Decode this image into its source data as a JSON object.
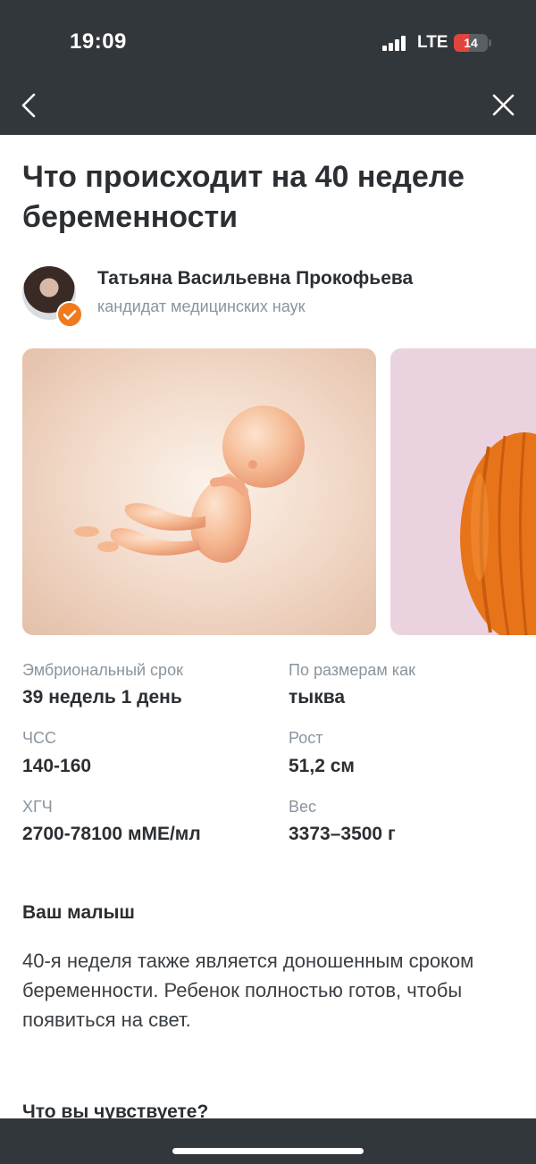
{
  "status_bar": {
    "time": "19:09",
    "network": "LTE",
    "battery": "14",
    "battery_fraction": 0.14,
    "icons": [
      "signal-icon",
      "battery-icon"
    ]
  },
  "nav": {
    "back_icon": "chevron-left-icon",
    "close_icon": "close-icon"
  },
  "article": {
    "title": "Что происходит на 40 неделе беременности",
    "author": {
      "name": "Татьяна Васильевна Прокофьева",
      "title": "кандидат медицинских наук",
      "badge_icon": "verified-check-icon"
    },
    "images": [
      "fetus-illustration",
      "pumpkin-illustration"
    ],
    "stats": {
      "term_label": "Эмбриональный срок",
      "term_value": "39 недель 1 день",
      "size_label": "По размерам как",
      "size_value": "тыква",
      "hr_label": "ЧСС",
      "hr_value": "140-160",
      "height_label": "Рост",
      "height_value": "51,2 см",
      "hcg_label": "ХГЧ",
      "hcg_value": "2700-78100 мМЕ/мл",
      "weight_label": "Вес",
      "weight_value": "3373–3500 г"
    },
    "section_baby": {
      "title": "Ваш малыш",
      "text": "40-я неделя также является доношенным сроком беременности. Ребенок полностью готов, чтобы появиться на свет."
    },
    "section_feel": {
      "title": "Что вы чувствуете?"
    }
  },
  "colors": {
    "bar": "#32373c",
    "accent": "#f07a1e",
    "muted_text": "#8a949d",
    "text": "#2b2f33",
    "battery_low": "#e0453c"
  }
}
